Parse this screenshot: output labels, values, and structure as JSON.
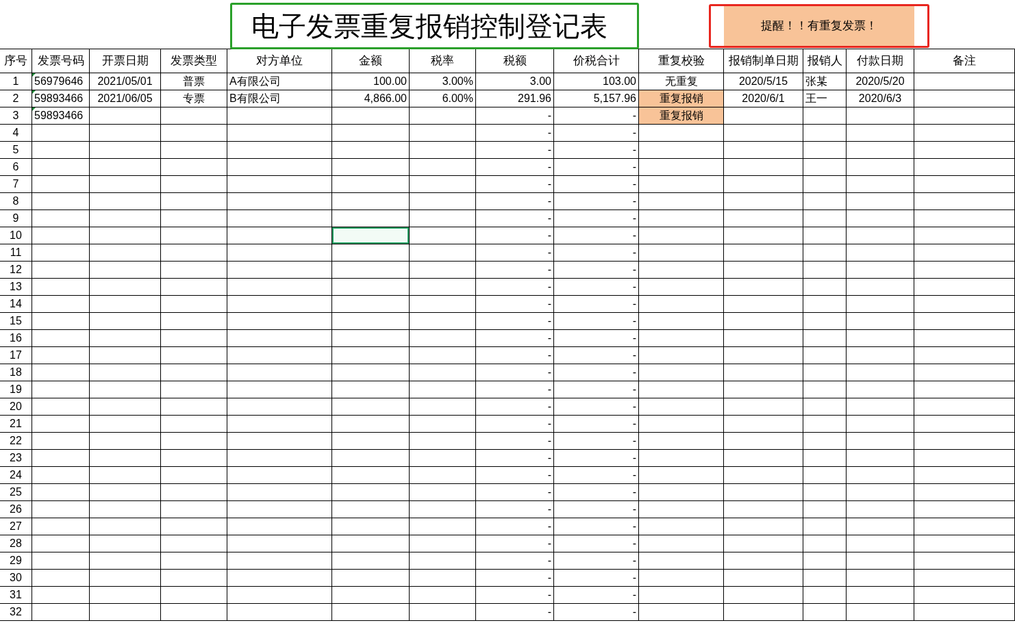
{
  "title": "电子发票重复报销控制登记表",
  "alert": "提醒！！有重复发票！",
  "columns": [
    "序号",
    "发票号码",
    "开票日期",
    "发票类型",
    "对方单位",
    "金额",
    "税率",
    "税额",
    "价税合计",
    "重复校验",
    "报销制单日期",
    "报销人",
    "付款日期",
    "备注"
  ],
  "rows": [
    {
      "no": "1",
      "invoice": "56979646",
      "date": "2021/05/01",
      "type": "普票",
      "party": "A有限公司",
      "amount": "100.00",
      "rate": "3.00%",
      "tax": "3.00",
      "total": "103.00",
      "check": {
        "text": "无重复",
        "duplicate": false
      },
      "claim_date": "2020/5/15",
      "claimant": "张某",
      "pay_date": "2020/5/20",
      "amount_selected": false
    },
    {
      "no": "2",
      "invoice": "59893466",
      "date": "2021/06/05",
      "type": "专票",
      "party": "B有限公司",
      "amount": "4,866.00",
      "rate": "6.00%",
      "tax": "291.96",
      "total": "5,157.96",
      "check": {
        "text": "重复报销",
        "duplicate": true
      },
      "claim_date": "2020/6/1",
      "claimant": "王一",
      "pay_date": "2020/6/3",
      "amount_selected": false
    },
    {
      "no": "3",
      "invoice": "59893466",
      "tax": "-",
      "total": "-",
      "check": {
        "text": "重复报销",
        "duplicate": true
      },
      "amount_selected": false
    },
    {
      "no": "4",
      "tax": "-",
      "total": "-",
      "amount_selected": false
    },
    {
      "no": "5",
      "tax": "-",
      "total": "-",
      "amount_selected": false
    },
    {
      "no": "6",
      "tax": "-",
      "total": "-",
      "amount_selected": false
    },
    {
      "no": "7",
      "tax": "-",
      "total": "-",
      "amount_selected": false
    },
    {
      "no": "8",
      "tax": "-",
      "total": "-",
      "amount_selected": false
    },
    {
      "no": "9",
      "tax": "-",
      "total": "-",
      "amount_selected": false
    },
    {
      "no": "10",
      "tax": "-",
      "total": "-",
      "amount_selected": true
    },
    {
      "no": "11",
      "tax": "-",
      "total": "-",
      "amount_selected": false
    },
    {
      "no": "12",
      "tax": "-",
      "total": "-",
      "amount_selected": false
    },
    {
      "no": "13",
      "tax": "-",
      "total": "-",
      "amount_selected": false
    },
    {
      "no": "14",
      "tax": "-",
      "total": "-",
      "amount_selected": false
    },
    {
      "no": "15",
      "tax": "-",
      "total": "-",
      "amount_selected": false
    },
    {
      "no": "16",
      "tax": "-",
      "total": "-",
      "amount_selected": false
    },
    {
      "no": "17",
      "tax": "-",
      "total": "-",
      "amount_selected": false
    },
    {
      "no": "18",
      "tax": "-",
      "total": "-",
      "amount_selected": false
    },
    {
      "no": "19",
      "tax": "-",
      "total": "-",
      "amount_selected": false
    },
    {
      "no": "20",
      "tax": "-",
      "total": "-",
      "amount_selected": false
    },
    {
      "no": "21",
      "tax": "-",
      "total": "-",
      "amount_selected": false
    },
    {
      "no": "22",
      "tax": "-",
      "total": "-",
      "amount_selected": false
    },
    {
      "no": "23",
      "tax": "-",
      "total": "-",
      "amount_selected": false
    },
    {
      "no": "24",
      "tax": "-",
      "total": "-",
      "amount_selected": false
    },
    {
      "no": "25",
      "tax": "-",
      "total": "-",
      "amount_selected": false
    },
    {
      "no": "26",
      "tax": "-",
      "total": "-",
      "amount_selected": false
    },
    {
      "no": "27",
      "tax": "-",
      "total": "-",
      "amount_selected": false
    },
    {
      "no": "28",
      "tax": "-",
      "total": "-",
      "amount_selected": false
    },
    {
      "no": "29",
      "tax": "-",
      "total": "-",
      "amount_selected": false
    },
    {
      "no": "30",
      "tax": "-",
      "total": "-",
      "amount_selected": false
    },
    {
      "no": "31",
      "tax": "-",
      "total": "-",
      "amount_selected": false
    },
    {
      "no": "32",
      "tax": "-",
      "total": "-",
      "amount_selected": false
    }
  ]
}
